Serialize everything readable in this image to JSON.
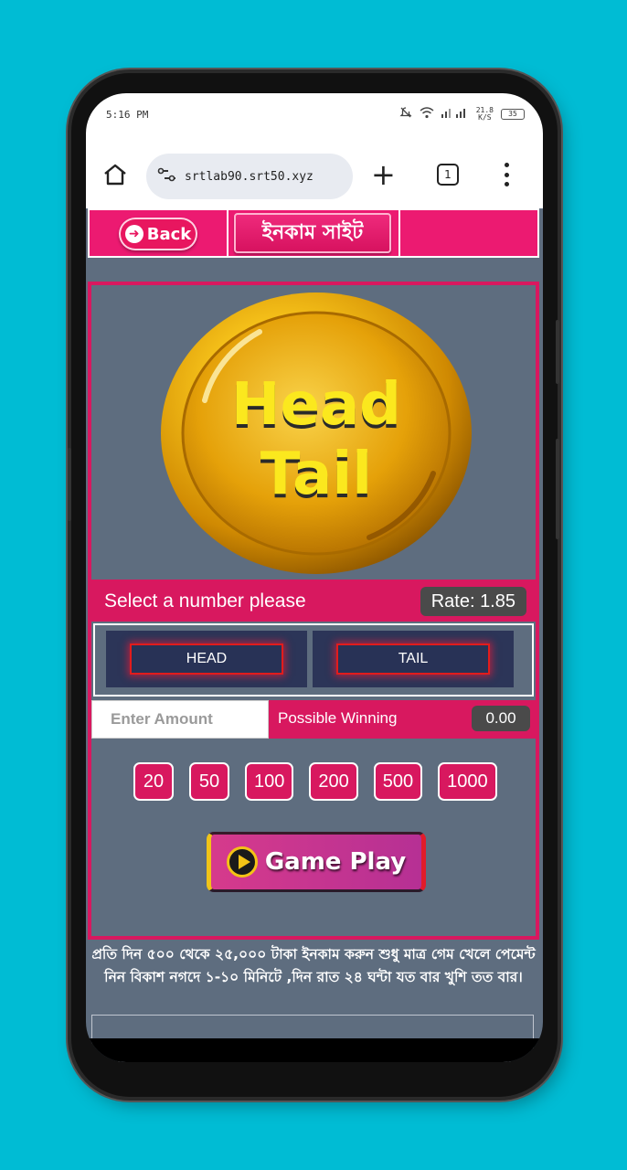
{
  "status_bar": {
    "time": "5:16 PM",
    "net_speed": "21.8",
    "net_unit": "K/S",
    "battery": "35"
  },
  "browser": {
    "url": "srtlab90.srt50.xyz",
    "tab_count": "1"
  },
  "nav": {
    "back_label": "Back",
    "site_title": "ইনকাম সাইট"
  },
  "game": {
    "coin_line1": "Head",
    "coin_line2": "Tail",
    "select_prompt": "Select a number please",
    "rate_label": "Rate: 1.85",
    "choices": [
      "HEAD",
      "TAIL"
    ],
    "amount_placeholder": "Enter Amount",
    "possible_winning_label": "Possible Winning",
    "possible_winning_value": "0.00",
    "amount_chips": [
      "20",
      "50",
      "100",
      "200",
      "500",
      "1000"
    ],
    "play_label": "Game Play"
  },
  "footer_note": "প্রতি দিন ৫০০ থেকে ২৫,০০০ টাকা ইনকাম করুন শুধু মাত্র গেম খেলে পেমেন্ট নিন বিকাশ নগদে ১-১০ মিনিটে ,দিন রাত ২৪ ঘন্টা যত বার খুশি তত বার।",
  "colors": {
    "background": "#00bcd4",
    "accent_pink": "#ec1a71",
    "panel_gray": "#5e6d7f",
    "choice_navy": "#2c3558",
    "coin_gold": "#f2b705"
  }
}
